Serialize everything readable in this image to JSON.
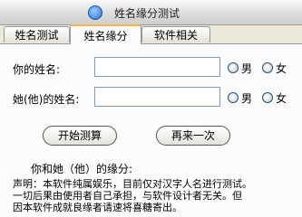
{
  "window": {
    "title": "姓名缘分测试"
  },
  "tabs": [
    {
      "label": "姓名测试"
    },
    {
      "label": "姓名缘分"
    },
    {
      "label": "软件相关"
    }
  ],
  "form": {
    "your_name_label": "你的姓名:",
    "your_name_value": "",
    "their_name_label": "她(他)的姓名:",
    "their_name_value": "",
    "male_label": "男",
    "female_label": "女"
  },
  "buttons": {
    "start": "开始测算",
    "again": "再来一次"
  },
  "result": {
    "label": "你和她（他）的缘分:"
  },
  "statement": {
    "line1": "声明：本软件纯属娱乐，目前仅对汉字人名进行测试。",
    "line2": "一切后果由使用者自己承担，与软件设计者无关。但",
    "line3": "因本软件成就良缘者请速将喜糖寄出。"
  }
}
